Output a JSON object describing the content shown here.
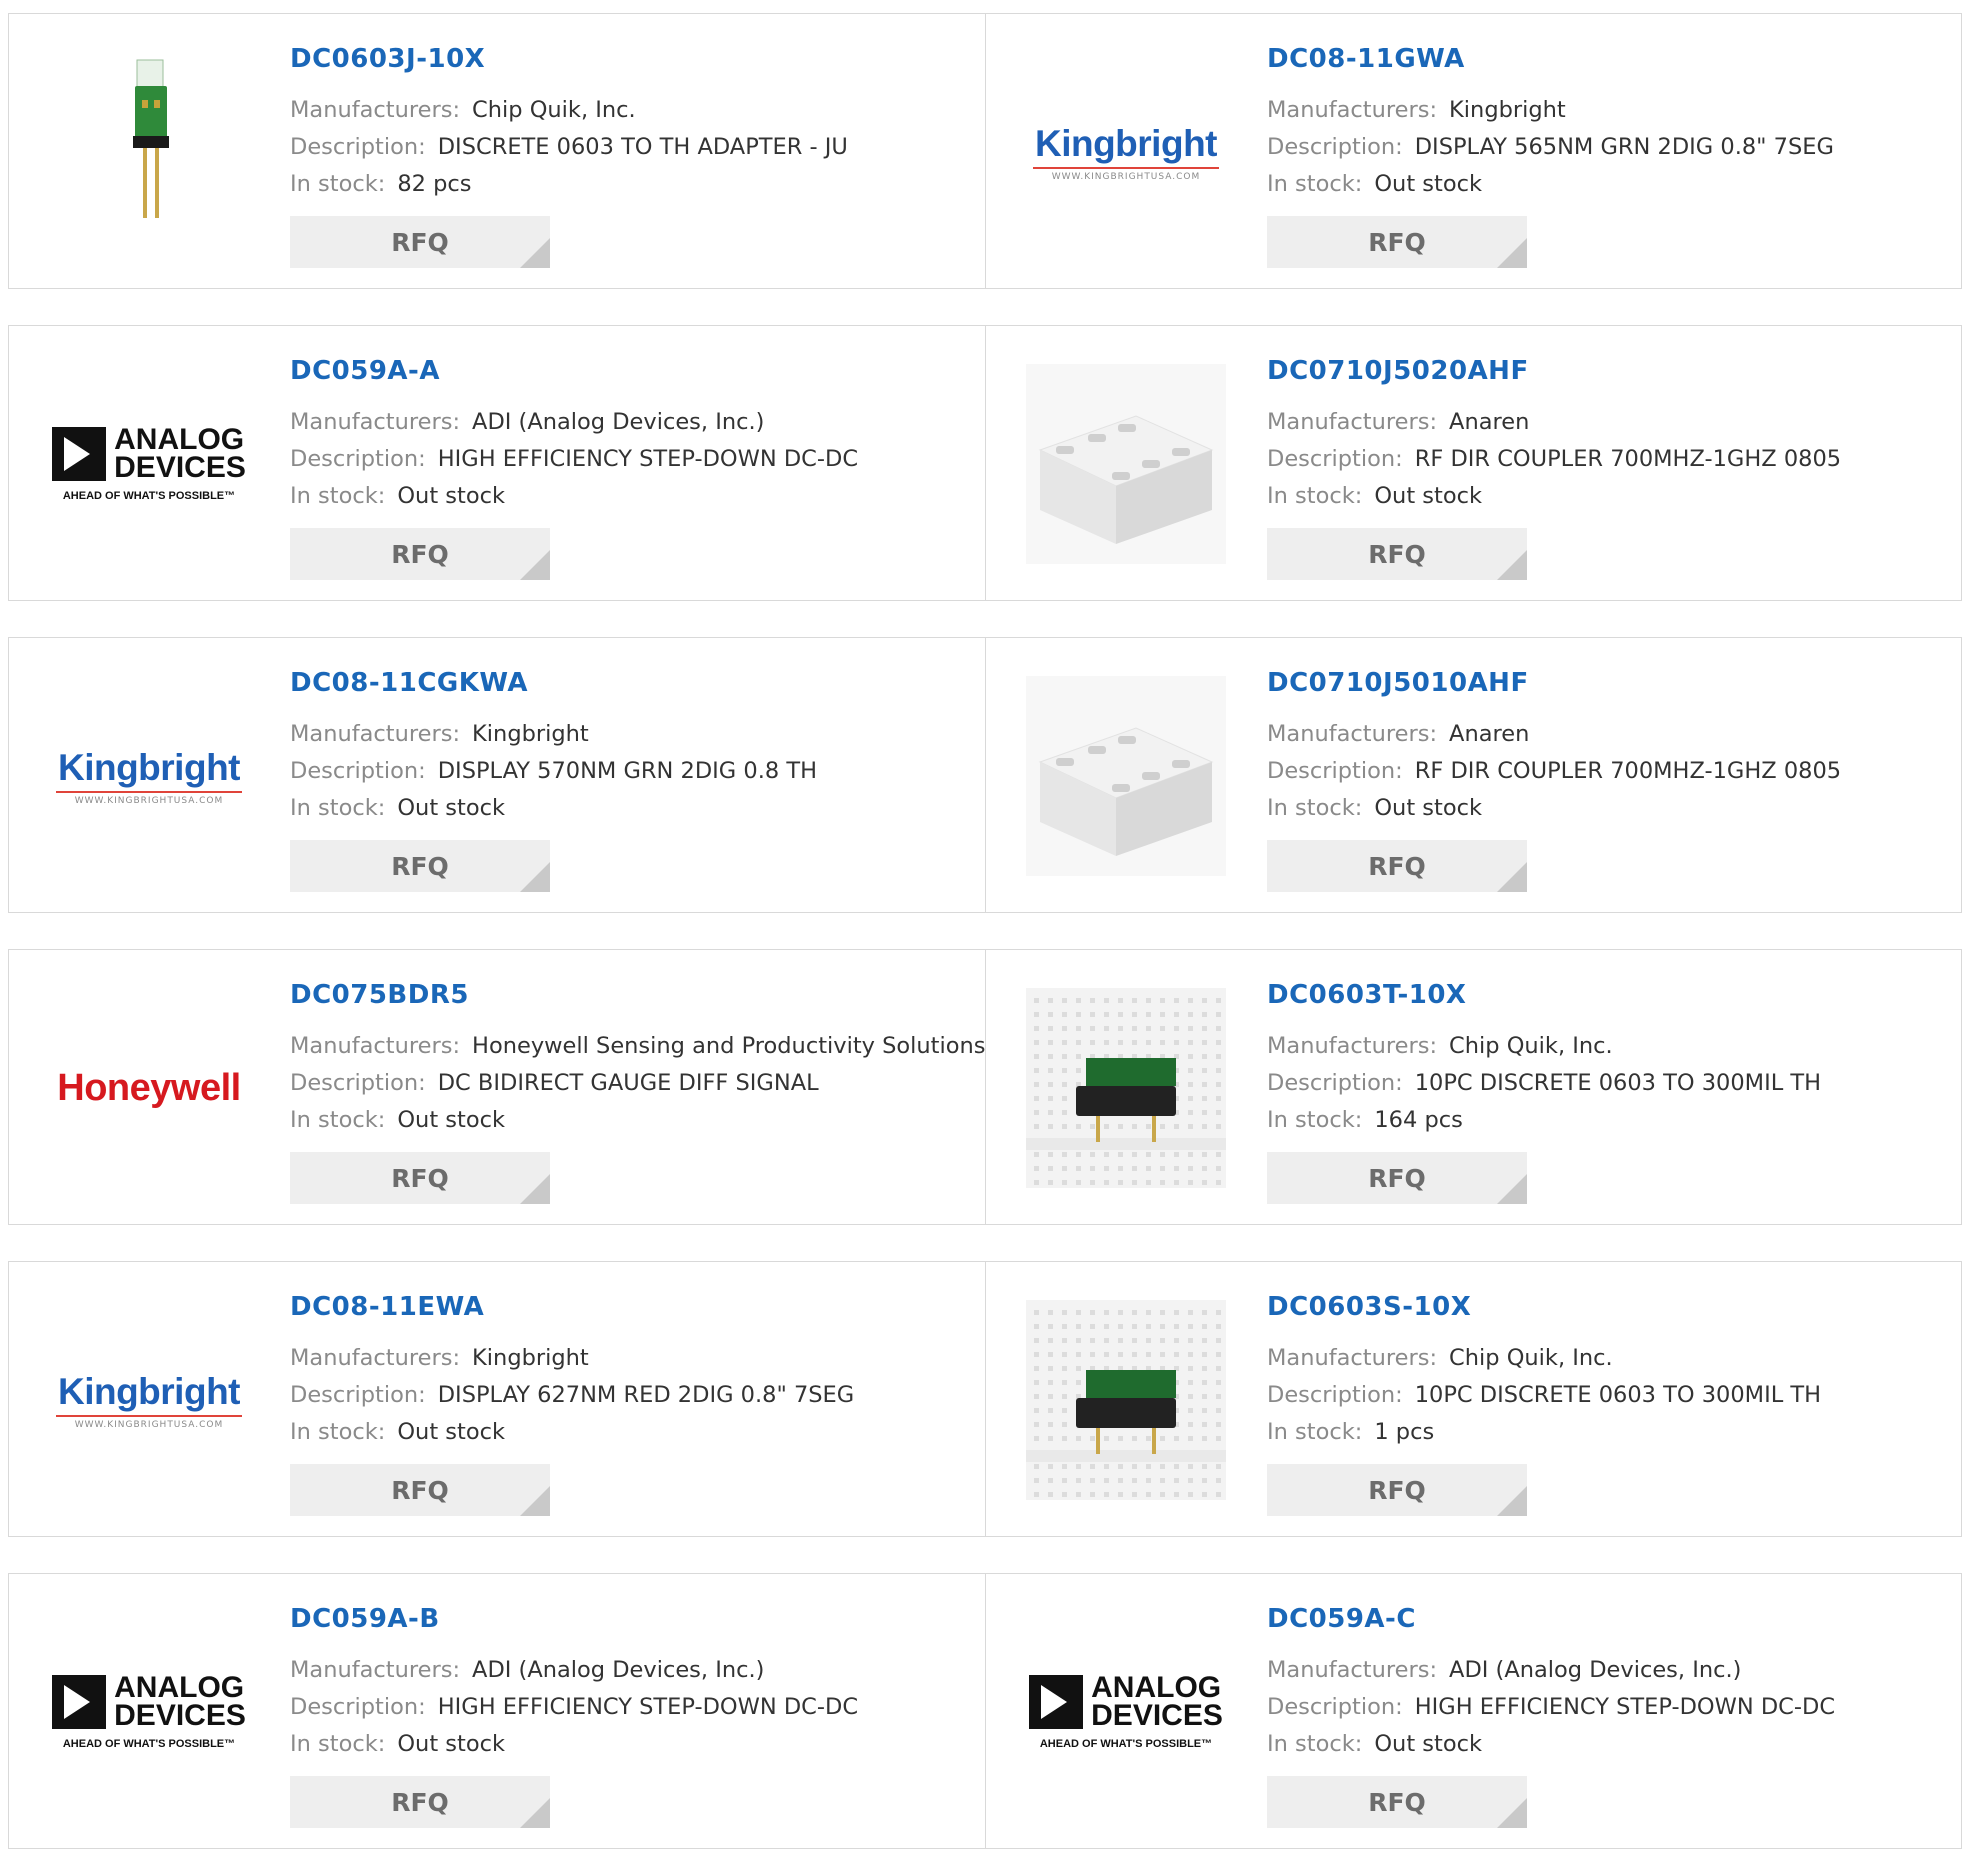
{
  "labels": {
    "manufacturers": "Manufacturers:",
    "description": "Description:",
    "stock": "In stock:",
    "rfq": "RFQ"
  },
  "logos": {
    "kingbright": {
      "name": "Kingbright",
      "url": "WWW.KINGBRIGHTUSA.COM"
    },
    "adi": {
      "line1": "ANALOG",
      "line2": "DEVICES",
      "tag": "AHEAD OF WHAT'S POSSIBLE™"
    },
    "honeywell": {
      "name": "Honeywell"
    }
  },
  "products": [
    {
      "part": "DC0603J-10X",
      "manufacturer": "Chip Quik, Inc.",
      "description": "DISCRETE 0603 TO TH ADAPTER - JU",
      "stock": "82 pcs",
      "image": "adapter-board-icon"
    },
    {
      "part": "DC08-11GWA",
      "manufacturer": "Kingbright",
      "description": "DISPLAY 565NM GRN 2DIG 0.8\" 7SEG",
      "stock": "Out stock",
      "image": "kingbright-logo"
    },
    {
      "part": "DC059A-A",
      "manufacturer": "ADI (Analog Devices, Inc.)",
      "description": "HIGH EFFICIENCY STEP-DOWN DC-DC",
      "stock": "Out stock",
      "image": "adi-logo"
    },
    {
      "part": "DC0710J5020AHF",
      "manufacturer": "Anaren",
      "description": "RF DIR COUPLER 700MHZ-1GHZ 0805",
      "stock": "Out stock",
      "image": "coupler-chip-icon"
    },
    {
      "part": "DC08-11CGKWA",
      "manufacturer": "Kingbright",
      "description": "DISPLAY 570NM GRN 2DIG 0.8 TH",
      "stock": "Out stock",
      "image": "kingbright-logo"
    },
    {
      "part": "DC0710J5010AHF",
      "manufacturer": "Anaren",
      "description": "RF DIR COUPLER 700MHZ-1GHZ 0805",
      "stock": "Out stock",
      "image": "coupler-chip-icon"
    },
    {
      "part": "DC075BDR5",
      "manufacturer": "Honeywell Sensing and Productivity Solutions",
      "description": "DC BIDIRECT GAUGE DIFF SIGNAL",
      "stock": "Out stock",
      "image": "honeywell-logo"
    },
    {
      "part": "DC0603T-10X",
      "manufacturer": "Chip Quik, Inc.",
      "description": "10PC DISCRETE 0603 TO 300MIL TH",
      "stock": "164 pcs",
      "image": "breadboard-adapter-icon"
    },
    {
      "part": "DC08-11EWA",
      "manufacturer": "Kingbright",
      "description": "DISPLAY 627NM RED 2DIG 0.8\" 7SEG",
      "stock": "Out stock",
      "image": "kingbright-logo"
    },
    {
      "part": "DC0603S-10X",
      "manufacturer": "Chip Quik, Inc.",
      "description": "10PC DISCRETE 0603 TO 300MIL TH",
      "stock": "1 pcs",
      "image": "breadboard-adapter-icon"
    },
    {
      "part": "DC059A-B",
      "manufacturer": "ADI (Analog Devices, Inc.)",
      "description": "HIGH EFFICIENCY STEP-DOWN DC-DC",
      "stock": "Out stock",
      "image": "adi-logo"
    },
    {
      "part": "DC059A-C",
      "manufacturer": "ADI (Analog Devices, Inc.)",
      "description": "HIGH EFFICIENCY STEP-DOWN DC-DC",
      "stock": "Out stock",
      "image": "adi-logo"
    }
  ]
}
